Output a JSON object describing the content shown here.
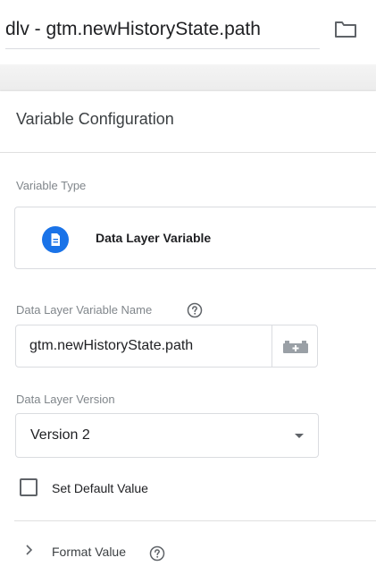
{
  "header": {
    "title": "dlv - gtm.newHistoryState.path",
    "folder_icon": "folder-icon"
  },
  "panel": {
    "title": "Variable Configuration",
    "variable_type": {
      "label": "Variable Type",
      "name": "Data Layer Variable",
      "icon": "document-icon",
      "icon_color": "#1a73e8"
    },
    "dlv_name": {
      "label": "Data Layer Variable Name",
      "value": "gtm.newHistoryState.path",
      "help_icon": "help-icon",
      "picker_icon": "brick-icon"
    },
    "version": {
      "label": "Data Layer Version",
      "value": "Version 2"
    },
    "default_value": {
      "label": "Set Default Value",
      "checked": false
    },
    "format_value": {
      "label": "Format Value"
    }
  }
}
